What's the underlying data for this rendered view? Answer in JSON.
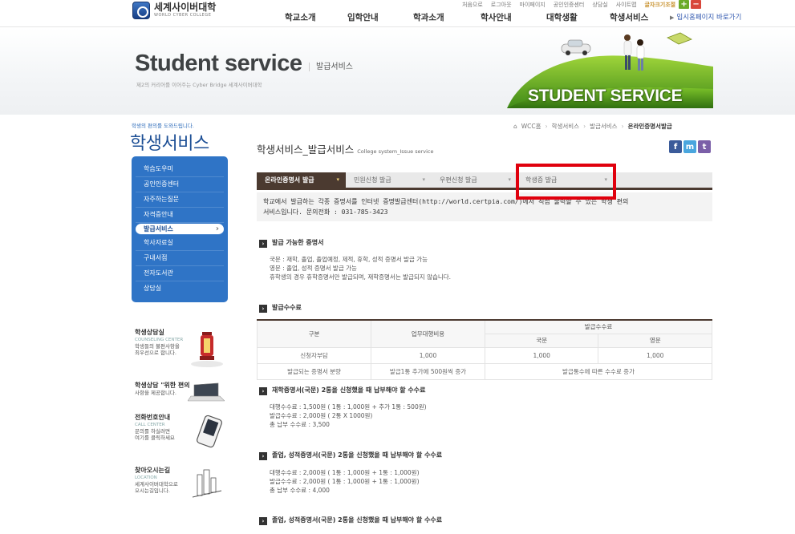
{
  "header": {
    "logo_ko": "세계사이버대학",
    "logo_en": "WORLD CYBER COLLEGE",
    "utility": [
      "처음으로",
      "로그아웃",
      "마이페이지",
      "공인인증센터",
      "상담실",
      "사이트맵"
    ],
    "font_size_label": "글자크기조절",
    "font_plus": "+",
    "font_minus": "−",
    "gnb": [
      "학교소개",
      "입학안내",
      "학과소개",
      "학사안내",
      "대학생활",
      "학생서비스"
    ],
    "admission_link": "입시홈페이지 바로가기"
  },
  "visual": {
    "title": "Student service",
    "subtitle": "발급서비스",
    "tagline": "제2의 커리어를 이어주는 Cyber Bridge 세계사이버대학",
    "banner_text": "STUDENT SERVICE"
  },
  "sidebar": {
    "caption": "학생의 편의를 도와드립니다.",
    "title": "학생서비스",
    "items": [
      {
        "label": "학습도우미"
      },
      {
        "label": "공인인증센터"
      },
      {
        "label": "자주하는질문"
      },
      {
        "label": "자격증안내"
      },
      {
        "label": "발급서비스"
      },
      {
        "label": "학사자료실"
      },
      {
        "label": "구내서점"
      },
      {
        "label": "전자도서관"
      },
      {
        "label": "상담실"
      }
    ],
    "banners": [
      {
        "title": "학생상담실",
        "en": "COUNSELING CENTER",
        "desc1": "학생들의 불편사항을",
        "desc2": "최우선으로 합니다."
      },
      {
        "title": "학생상담 \"위한 편의",
        "en": "",
        "desc1": "사항을 제공합니다.",
        "desc2": ""
      },
      {
        "title": "전화번호안내",
        "en": "CALL CENTER",
        "desc1": "문의를 하실려면",
        "desc2": "여기를 클릭하세요"
      },
      {
        "title": "찾아오시는길",
        "en": "LOCATION",
        "desc1": "세계사이버대학으로",
        "desc2": "오시는길입니다."
      }
    ]
  },
  "content": {
    "breadcrumb": [
      "WCC홈",
      "학생서비스",
      "발급서비스",
      "온라인증명서발급"
    ],
    "title": "학생서비스_발급서비스",
    "title_en": "College system_Issue service",
    "sns": {
      "facebook": "f",
      "me2day": "m",
      "twitter": "t"
    },
    "tabs": [
      {
        "label": "온라인증명서 발급"
      },
      {
        "label": "민원신청 발급"
      },
      {
        "label": "우편신청 발급"
      },
      {
        "label": "학생증 발급"
      }
    ],
    "intro_line1": "학교에서 발급하는 각종 증명서를 인터넷 증명발급센터(http://world.certpia.com/)에서 직접 출력할 수 있는 학생 편의",
    "intro_line2": "서비스입니다. 문의전화 : 031-785-3423",
    "sections": {
      "certs": {
        "title": "발급 가능한 증명서",
        "lines": [
          "국문 : 재학, 졸업, 졸업예정, 제적, 휴학, 성적 증명서 발급 가능",
          "영문 : 졸업, 성적 증명서 발급 가능",
          "휴학생의 경우 휴학증명서만 발급되며, 재학증명서는 발급되지 않습니다."
        ]
      },
      "fee": {
        "title": "발급수수료"
      },
      "case1": {
        "title": "재학증명서(국문) 2통을 신청했을 때 납부해야 할 수수료",
        "lines": [
          "대행수수료 : 1,500원 ( 1통 : 1,000원 + 추가 1통 : 500원)",
          "발급수수료 : 2,000원 ( 2통 X 1000원)",
          "총 납부 수수료 : 3,500"
        ]
      },
      "case2": {
        "title": "졸업, 성적증명서(국문) 2통을 신청했을 때 납부해야 할 수수료",
        "lines": [
          "대행수수료 : 2,000원 ( 1통 : 1,000원 + 1통 : 1,000원)",
          "발급수수료 : 2,000원 ( 1통 : 1,000원 + 1통 : 1,000원)",
          "총 납부 수수료 : 4,000"
        ]
      },
      "case3": {
        "title": "졸업, 성적증명서(국문) 2통을 신청했을 때 납부해야 할 수수료"
      }
    },
    "fee_table": {
      "h_gubun": "구분",
      "h_agency": "업무대행비용",
      "h_issue": "발급수수료",
      "h_ko": "국문",
      "h_en": "영문",
      "row1": {
        "label": "신청자부담",
        "agency": "1,000",
        "ko": "1,000",
        "en": "1,000"
      },
      "row2": {
        "label": "발급되는 증명서 분량",
        "agency": "발급1통 추가에 500원씩 증가",
        "issue": "발급통수에 따른 수수료 증가"
      }
    }
  },
  "colors": {
    "accent_blue": "#2f74c6",
    "tab_brown": "#4b3a30",
    "highlight_red": "#e0000d"
  }
}
